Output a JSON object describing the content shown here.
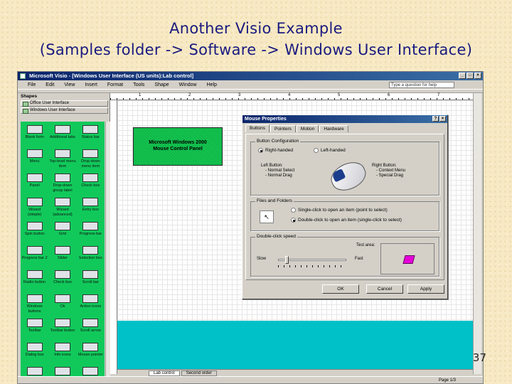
{
  "slide": {
    "title_line1": "Another Visio Example",
    "title_line2": "(Samples folder -> Software -> Windows User Interface)",
    "page_number": "37"
  },
  "window": {
    "title": "Microsoft Visio - [Windows User Interface (US units):Lab control]",
    "menu": [
      "File",
      "Edit",
      "View",
      "Insert",
      "Format",
      "Tools",
      "Shape",
      "Window",
      "Help"
    ],
    "help_placeholder": "Type a question for help",
    "controls": [
      "_",
      "□",
      "×"
    ]
  },
  "shapes_panel": {
    "title": "Shapes",
    "stencils": [
      "Office User Interface",
      "Windows User Interface"
    ],
    "items": [
      "Blank form",
      "Additional tabs",
      "Status bar",
      "Menu",
      "Top-level menu item",
      "Drop-down menu item",
      "Panel",
      "Drop-down group label",
      "Check box",
      "Wizard (simple)",
      "Wizard (advanced)",
      "Entry box",
      "Spin button",
      "Grid",
      "Progress bar",
      "Progress bar 2",
      "Slider",
      "Selection box",
      "Radio button",
      "Check box",
      "Scroll bar",
      "Windows buttons",
      "Ok",
      "Action icons",
      "Toolbar",
      "Toolbar button",
      "Scroll arrow",
      "Dialog box",
      "Info icons",
      "Mouse pointer",
      "Disclosure",
      "Tab",
      "Pointers"
    ]
  },
  "ruler": [
    "1",
    "2",
    "3",
    "4",
    "5",
    "6",
    "7",
    "8"
  ],
  "canvas": {
    "panel_label_line1": "Microsoft Windows 2000",
    "panel_label_line2": "Mouse Control Panel"
  },
  "dialog": {
    "title": "Mouse Properties",
    "tabs": [
      "Buttons",
      "Pointers",
      "Motion",
      "Hardware"
    ],
    "button_config": {
      "group_title": "Button Configuration",
      "right_handed": "Right-handed",
      "left_handed": "Left-handed",
      "left_button_title": "Left Button:",
      "left_button_items": [
        "- Normal Select",
        "- Normal Drag"
      ],
      "right_button_title": "Right Button:",
      "right_button_items": [
        "- Context Menu",
        "- Special Drag"
      ]
    },
    "files_folders": {
      "group_title": "Files and Folders",
      "single_click": "Single-click to open an item (point to select)",
      "double_click": "Double-click to open an item (single-click to select)"
    },
    "double_click_speed": {
      "group_title": "Double-click speed",
      "test_area": "Test area:",
      "slow": "Slow",
      "fast": "Fast",
      "value_fraction": 0.1
    },
    "buttons": {
      "ok": "OK",
      "cancel": "Cancel",
      "apply": "Apply"
    }
  },
  "page_tabs": [
    "Lab control",
    "Second order"
  ],
  "status": "Page 1/3"
}
